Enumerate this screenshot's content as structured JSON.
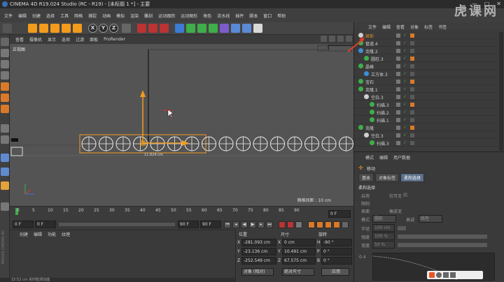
{
  "window": {
    "title": "CINEMA 4D R19.024 Studio (RC - R19) - [未标题 1 *] - 主要",
    "watermark": "虎课网",
    "controls": [
      "—",
      "□",
      "✕"
    ]
  },
  "menubar": [
    "文件",
    "编辑",
    "创建",
    "选择",
    "工具",
    "网格",
    "捕捉",
    "动画",
    "模拟",
    "渲染",
    "雕刻",
    "运动跟踪",
    "运动图形",
    "角色",
    "流水线",
    "插件",
    "脚本",
    "窗口",
    "帮助"
  ],
  "toolbar": {
    "axes": [
      "X",
      "Y",
      "Z"
    ]
  },
  "viewport": {
    "menu": [
      "查看",
      "摄像机",
      "显示",
      "选项",
      "过滤",
      "面板",
      "ProRender"
    ],
    "label": "正视图",
    "measure": "11.829 cm",
    "grid_info": "网格间距 : 10 cm",
    "circle_count": 18
  },
  "timeline": {
    "ticks": [
      "0",
      "5",
      "10",
      "15",
      "20",
      "25",
      "30",
      "35",
      "40",
      "45",
      "50",
      "55",
      "60",
      "65",
      "70",
      "75",
      "80",
      "85",
      "90"
    ],
    "end_frame": "0 F"
  },
  "transport": {
    "current": "0 F",
    "start": "0 F",
    "end": "90 F",
    "end2": "90 F"
  },
  "material": {
    "menu": [
      "创建",
      "编辑",
      "功能",
      "纹理"
    ],
    "side_label": "MAXON CINEMA 4D"
  },
  "coordinates": {
    "headers": [
      "位置",
      "尺寸",
      "旋转"
    ],
    "rows": [
      {
        "axis": "X",
        "pos": "-281.093 cm",
        "size_axis": "X",
        "size": "0 cm",
        "rot_axis": "H",
        "rot": "-90 °"
      },
      {
        "axis": "Y",
        "pos": "-23.136 cm",
        "size_axis": "Y",
        "size": "10.491 cm",
        "rot_axis": "P",
        "rot": "0 °"
      },
      {
        "axis": "Z",
        "pos": "-252.549 cm",
        "size_axis": "Z",
        "size": "67.575 cm",
        "rot_axis": "B",
        "rot": "0 °"
      }
    ],
    "mode": "对象 (相对)",
    "size_mode": "绝对尺寸",
    "apply": "应用"
  },
  "object_manager": {
    "menu": [
      "文件",
      "编辑",
      "查看",
      "对象",
      "标签",
      "书签"
    ],
    "objects": [
      {
        "name": "矩形",
        "indent": 0
      },
      {
        "name": "管道.4",
        "indent": 0
      },
      {
        "name": "克隆.2",
        "indent": 0
      },
      {
        "name": "圆柱.3",
        "indent": 1
      },
      {
        "name": "晶格",
        "indent": 0
      },
      {
        "name": "立方体.3",
        "indent": 1
      },
      {
        "name": "宝石",
        "indent": 0
      },
      {
        "name": "克隆.1",
        "indent": 0
      },
      {
        "name": "空白.3",
        "indent": 1
      },
      {
        "name": "扫描.3",
        "indent": 2
      },
      {
        "name": "扫描.2",
        "indent": 2
      },
      {
        "name": "扫描.1",
        "indent": 2
      },
      {
        "name": "克隆",
        "indent": 0
      },
      {
        "name": "空白.3",
        "indent": 1
      },
      {
        "name": "扫描.3",
        "indent": 2
      }
    ]
  },
  "attributes": {
    "menu": [
      "模式",
      "编辑",
      "用户数据"
    ],
    "object": "移动",
    "tabs": [
      "基本",
      "对象标签",
      "柔和选择"
    ],
    "section": "柔和选择",
    "fields": [
      {
        "label": "启用",
        "value": ""
      },
      {
        "label": "限制",
        "value": "仅可见"
      },
      {
        "label": "表面",
        "value": ""
      },
      {
        "label": "橡皮泥",
        "value": ""
      },
      {
        "label": "模式",
        "value": "圆形"
      },
      {
        "label": "衰减",
        "value": "线性"
      },
      {
        "label": "半径",
        "value": "100 cm"
      },
      {
        "label": "强度",
        "value": "100 %"
      },
      {
        "label": "宽度",
        "value": "50 %"
      }
    ],
    "graph_label": "0.4"
  },
  "status": {
    "text": "15:52 cm  实时检测功能"
  },
  "colors": {
    "accent_orange": "#f29b1d",
    "highlight_blue": "#5b6f8c",
    "selection_box": "#f39a26",
    "red_arrow": "#e83b2b"
  }
}
